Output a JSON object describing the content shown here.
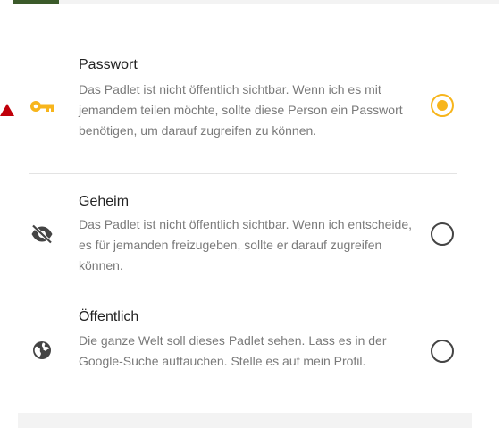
{
  "colors": {
    "accent": "#f7b51c",
    "title_text": "#222222",
    "description_text": "#7a7a7a",
    "icon_gray": "#444444",
    "pointer": "#c0000a"
  },
  "privacy_options": [
    {
      "title": "Passwort",
      "description": "Das Padlet ist nicht öffentlich sichtbar. Wenn ich es mit jemandem teilen möchte, sollte diese Person ein Passwort benötigen, um darauf zugreifen zu können.",
      "icon": "key-icon",
      "selected": true
    },
    {
      "title": "Geheim",
      "description": "Das Padlet ist nicht öffentlich sichtbar. Wenn ich entscheide, es für jemanden freizugeben, sollte er darauf zugreifen können.",
      "icon": "eye-off-icon",
      "selected": false
    },
    {
      "title": "Öffentlich",
      "description": "Die ganze Welt soll dieses Padlet sehen. Lass es in der Google-Suche auftauchen. Stelle es auf mein Profil.",
      "icon": "globe-icon",
      "selected": false
    }
  ]
}
